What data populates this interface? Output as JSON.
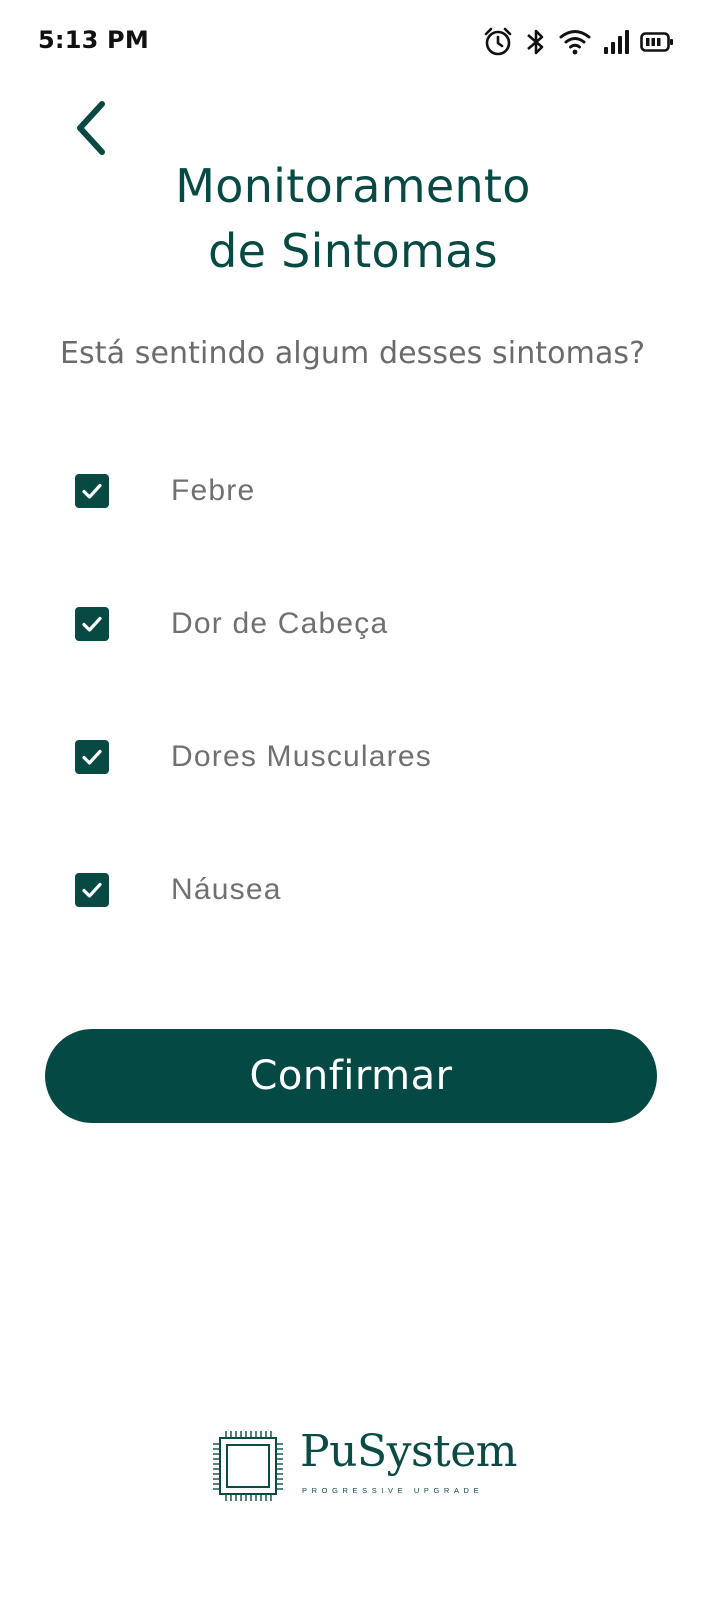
{
  "status_bar": {
    "time": "5:13 PM",
    "icons": [
      "alarm-icon",
      "bluetooth-icon",
      "wifi-icon",
      "signal-icon",
      "battery-icon"
    ]
  },
  "header": {
    "back_icon": "chevron-left-icon",
    "title_line1": "Monitoramento",
    "title_line2": "de Sintomas"
  },
  "question": "Está sentindo algum desses sintomas?",
  "symptoms": [
    {
      "label": "Febre",
      "checked": true
    },
    {
      "label": "Dor de Cabeça",
      "checked": true
    },
    {
      "label": "Dores Musculares",
      "checked": true
    },
    {
      "label": "Náusea",
      "checked": true
    }
  ],
  "confirm_label": "Confirmar",
  "brand": {
    "name": "PuSystem",
    "tagline": "PROGRESSIVE UPGRADE"
  },
  "colors": {
    "primary": "#064a43",
    "button": "#054945",
    "text_muted": "#707070"
  }
}
